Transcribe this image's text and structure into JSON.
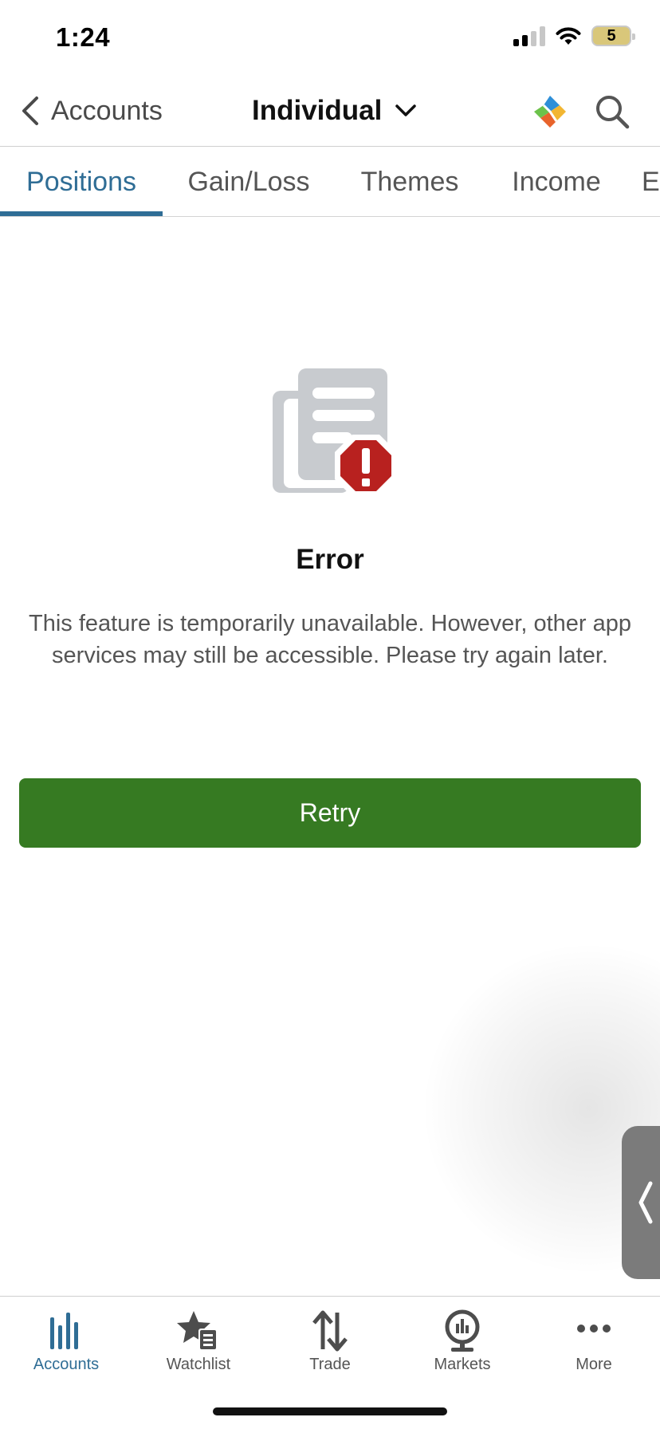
{
  "status_bar": {
    "time": "1:24",
    "battery": "5"
  },
  "nav": {
    "back_label": "Accounts",
    "title": "Individual"
  },
  "tabs": [
    {
      "label": "Positions",
      "active": true
    },
    {
      "label": "Gain/Loss",
      "active": false
    },
    {
      "label": "Themes",
      "active": false
    },
    {
      "label": "Income",
      "active": false
    },
    {
      "label": "E",
      "active": false
    }
  ],
  "error": {
    "title": "Error",
    "message": "This feature is temporarily unavailable. However, other app services may still be accessible. Please try again later.",
    "retry_label": "Retry"
  },
  "tab_bar": [
    {
      "label": "Accounts",
      "icon": "bar-chart-icon",
      "active": true
    },
    {
      "label": "Watchlist",
      "icon": "star-list-icon",
      "active": false
    },
    {
      "label": "Trade",
      "icon": "up-down-arrows-icon",
      "active": false
    },
    {
      "label": "Markets",
      "icon": "globe-chart-icon",
      "active": false
    },
    {
      "label": "More",
      "icon": "ellipsis-icon",
      "active": false
    }
  ],
  "colors": {
    "accent": "#2f6d95",
    "retry_button": "#367a22",
    "error_badge": "#b8211f",
    "document_icon": "#c8cbcf"
  }
}
